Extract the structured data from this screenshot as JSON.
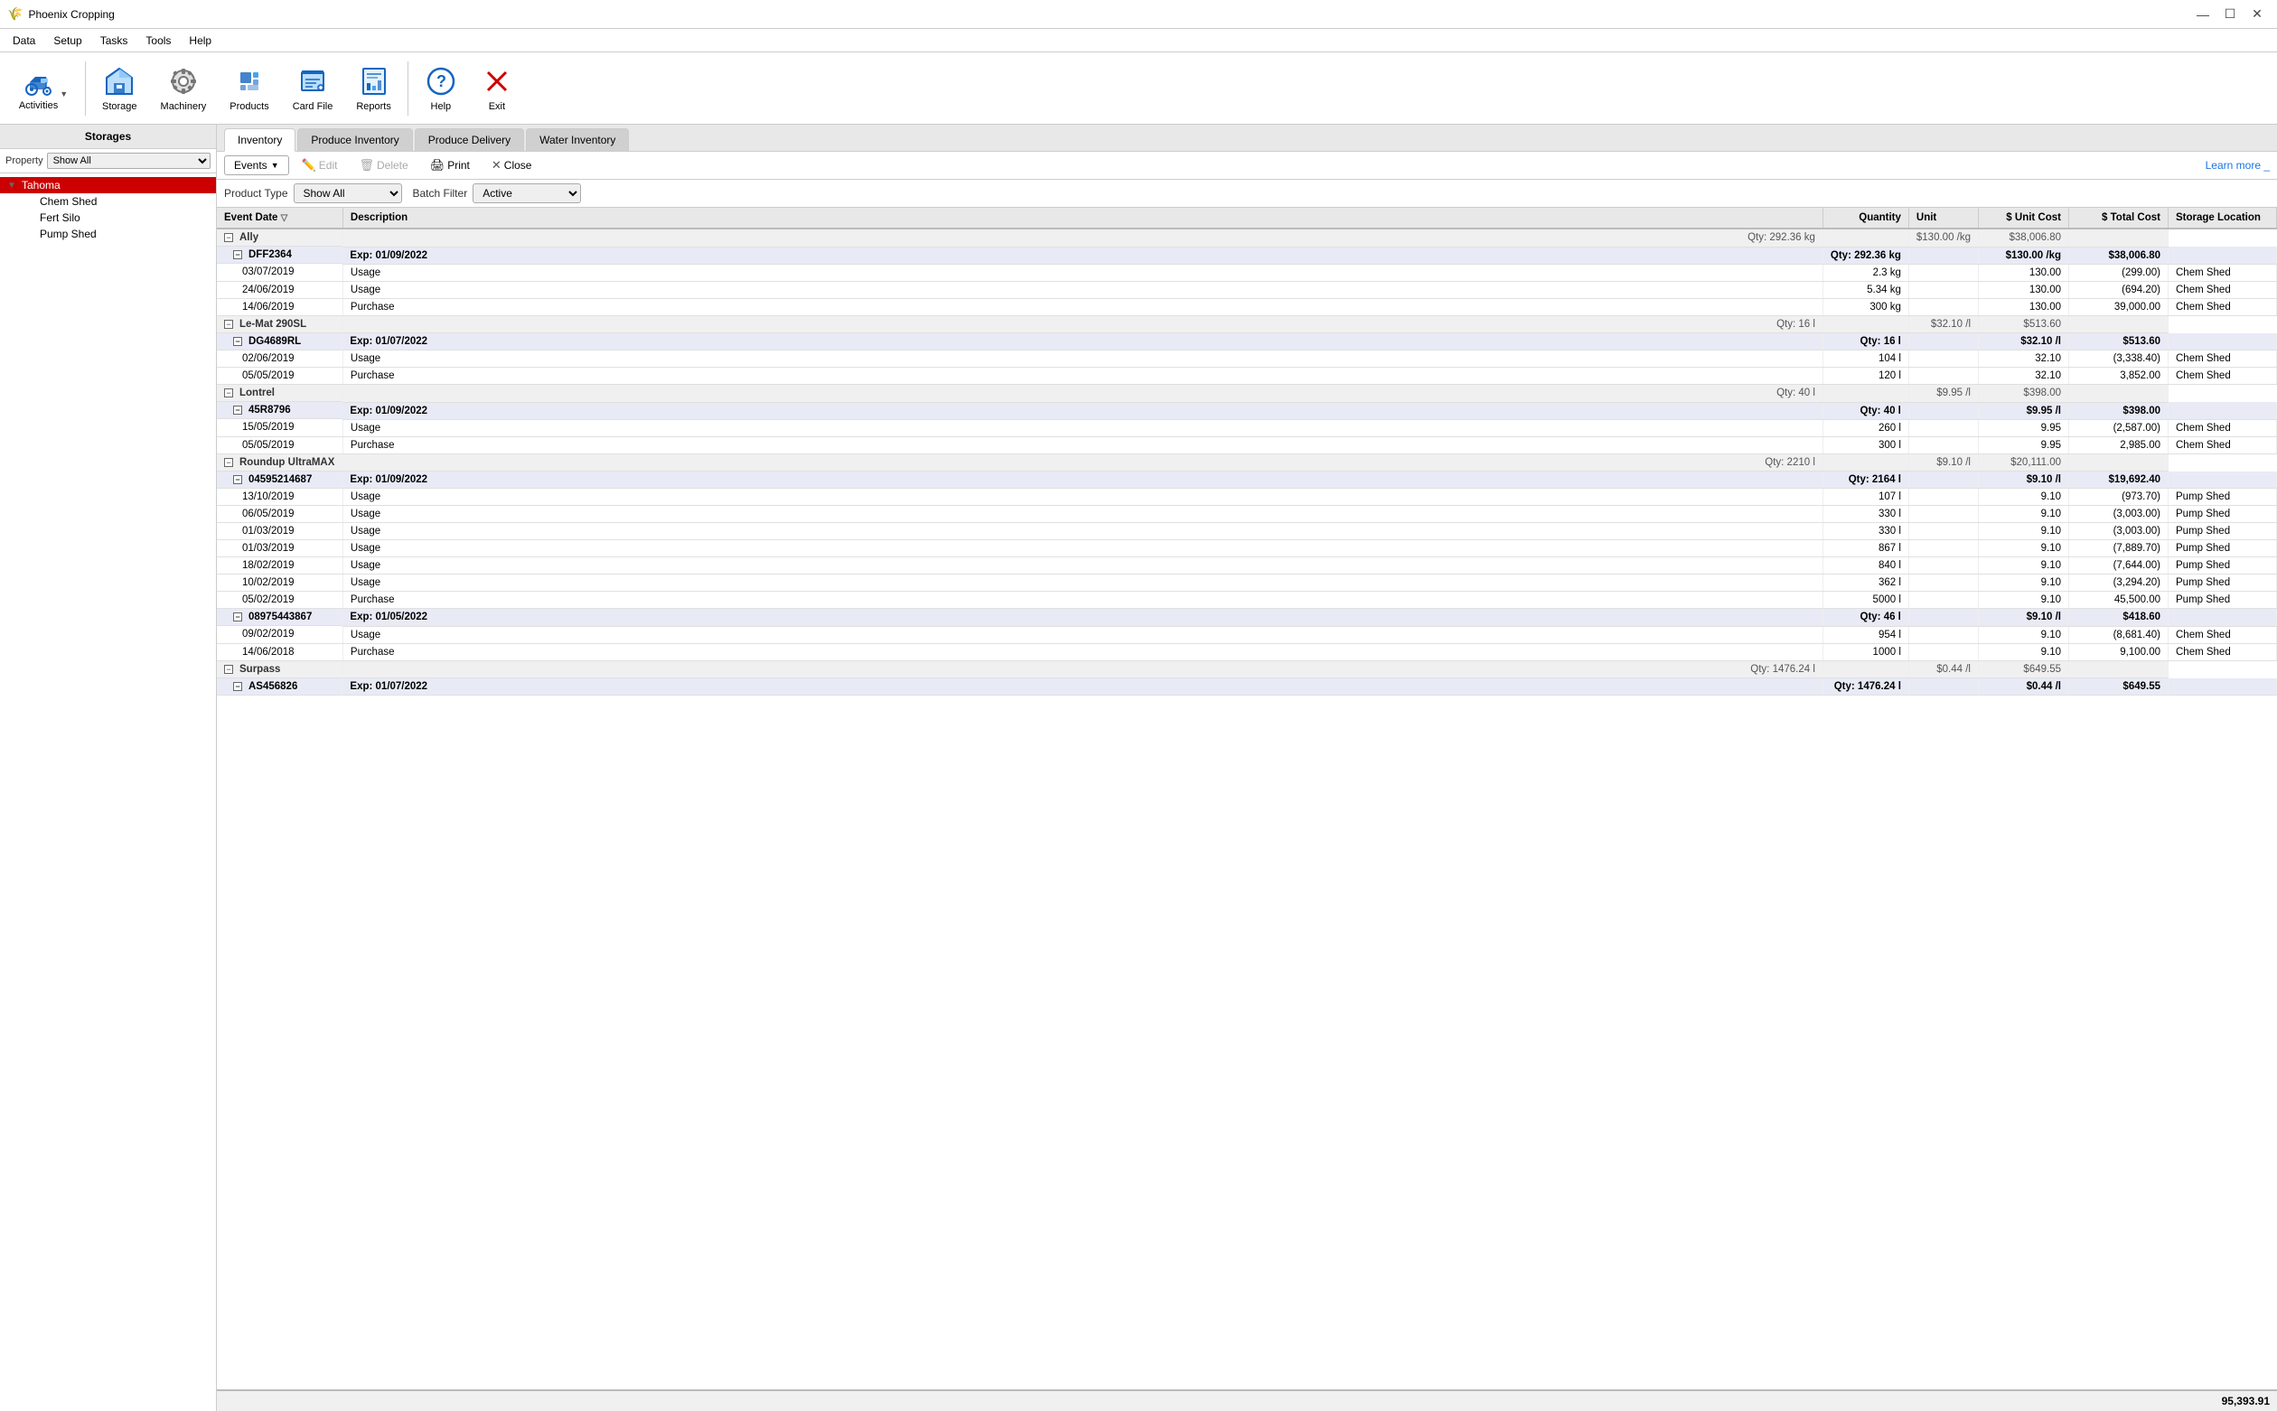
{
  "app": {
    "title": "Phoenix Cropping",
    "title_icon": "🌱"
  },
  "titlebar": {
    "minimize": "—",
    "maximize": "☐",
    "close": "✕"
  },
  "menu": {
    "items": [
      "Data",
      "Setup",
      "Tasks",
      "Tools",
      "Help"
    ]
  },
  "toolbar": {
    "buttons": [
      {
        "id": "activities",
        "label": "Activities",
        "icon": "🚜",
        "has_arrow": true
      },
      {
        "id": "storage",
        "label": "Storage",
        "icon": "🏚"
      },
      {
        "id": "machinery",
        "label": "Machinery",
        "icon": "⚙"
      },
      {
        "id": "products",
        "label": "Products",
        "icon": "📦"
      },
      {
        "id": "cardfile",
        "label": "Card File",
        "icon": "📋"
      },
      {
        "id": "reports",
        "label": "Reports",
        "icon": "📊"
      },
      {
        "id": "help",
        "label": "Help",
        "icon": "❓"
      },
      {
        "id": "exit",
        "label": "Exit",
        "icon": "✕"
      }
    ]
  },
  "sidebar": {
    "header": "Storages",
    "filter_label": "Property",
    "filter_value": "Show All",
    "filter_options": [
      "Show All"
    ],
    "tree": [
      {
        "id": "tahoma",
        "label": "Tahoma",
        "level": 0,
        "selected": true,
        "expanded": true
      },
      {
        "id": "chem-shed",
        "label": "Chem Shed",
        "level": 1
      },
      {
        "id": "fert-silo",
        "label": "Fert Silo",
        "level": 1
      },
      {
        "id": "pump-shed",
        "label": "Pump Shed",
        "level": 1
      }
    ]
  },
  "tabs": {
    "items": [
      {
        "id": "inventory",
        "label": "Inventory",
        "active": true
      },
      {
        "id": "produce-inventory",
        "label": "Produce Inventory",
        "active": false
      },
      {
        "id": "produce-delivery",
        "label": "Produce Delivery",
        "active": false
      },
      {
        "id": "water-inventory",
        "label": "Water Inventory",
        "active": false
      }
    ]
  },
  "action_bar": {
    "events_label": "Events",
    "edit_label": "Edit",
    "delete_label": "Delete",
    "print_label": "Print",
    "close_label": "Close",
    "learn_more": "Learn more _"
  },
  "filter_bar": {
    "product_type_label": "Product Type",
    "product_type_value": "Show All",
    "batch_filter_label": "Batch Filter",
    "batch_filter_value": "Active"
  },
  "table": {
    "columns": [
      {
        "id": "event-date",
        "label": "Event Date",
        "sortable": true
      },
      {
        "id": "description",
        "label": "Description"
      },
      {
        "id": "quantity",
        "label": "Quantity"
      },
      {
        "id": "unit",
        "label": "Unit"
      },
      {
        "id": "unit-cost",
        "label": "$ Unit Cost"
      },
      {
        "id": "total-cost",
        "label": "$ Total Cost"
      },
      {
        "id": "storage-location",
        "label": "Storage Location"
      }
    ],
    "rows": [
      {
        "type": "group-summary",
        "product": "Ally",
        "qty": "Qty: 292.36 kg",
        "unit_cost": "$130.00 /kg",
        "total_cost": "$38,006.80"
      },
      {
        "type": "batch",
        "batch": "DFF2364",
        "exp": "Exp: 01/09/2022",
        "qty": "Qty: 292.36 kg",
        "unit_cost": "$130.00 /kg",
        "total_cost": "$38,006.80"
      },
      {
        "type": "detail",
        "date": "03/07/2019",
        "desc": "Usage",
        "quantity": "2.3 kg",
        "unit_cost": "130.00",
        "total_cost": "(299.00)",
        "location": "Chem Shed"
      },
      {
        "type": "detail",
        "date": "24/06/2019",
        "desc": "Usage",
        "quantity": "5.34 kg",
        "unit_cost": "130.00",
        "total_cost": "(694.20)",
        "location": "Chem Shed"
      },
      {
        "type": "detail",
        "date": "14/06/2019",
        "desc": "Purchase",
        "quantity": "300 kg",
        "unit_cost": "130.00",
        "total_cost": "39,000.00",
        "location": "Chem Shed"
      },
      {
        "type": "group-summary",
        "product": "Le-Mat 290SL",
        "qty": "Qty: 16 l",
        "unit_cost": "$32.10 /l",
        "total_cost": "$513.60"
      },
      {
        "type": "batch",
        "batch": "DG4689RL",
        "exp": "Exp: 01/07/2022",
        "qty": "Qty: 16 l",
        "unit_cost": "$32.10 /l",
        "total_cost": "$513.60"
      },
      {
        "type": "detail",
        "date": "02/06/2019",
        "desc": "Usage",
        "quantity": "104 l",
        "unit_cost": "32.10",
        "total_cost": "(3,338.40)",
        "location": "Chem Shed"
      },
      {
        "type": "detail",
        "date": "05/05/2019",
        "desc": "Purchase",
        "quantity": "120 l",
        "unit_cost": "32.10",
        "total_cost": "3,852.00",
        "location": "Chem Shed"
      },
      {
        "type": "group-summary",
        "product": "Lontrel",
        "qty": "Qty: 40 l",
        "unit_cost": "$9.95 /l",
        "total_cost": "$398.00"
      },
      {
        "type": "batch",
        "batch": "45R8796",
        "exp": "Exp: 01/09/2022",
        "qty": "Qty: 40 l",
        "unit_cost": "$9.95 /l",
        "total_cost": "$398.00"
      },
      {
        "type": "detail",
        "date": "15/05/2019",
        "desc": "Usage",
        "quantity": "260 l",
        "unit_cost": "9.95",
        "total_cost": "(2,587.00)",
        "location": "Chem Shed"
      },
      {
        "type": "detail",
        "date": "05/05/2019",
        "desc": "Purchase",
        "quantity": "300 l",
        "unit_cost": "9.95",
        "total_cost": "2,985.00",
        "location": "Chem Shed"
      },
      {
        "type": "group-summary",
        "product": "Roundup UltraMAX",
        "qty": "Qty: 2210 l",
        "unit_cost": "$9.10 /l",
        "total_cost": "$20,111.00"
      },
      {
        "type": "batch",
        "batch": "04595214687",
        "exp": "Exp: 01/09/2022",
        "qty": "Qty: 2164 l",
        "unit_cost": "$9.10 /l",
        "total_cost": "$19,692.40"
      },
      {
        "type": "detail",
        "date": "13/10/2019",
        "desc": "Usage",
        "quantity": "107 l",
        "unit_cost": "9.10",
        "total_cost": "(973.70)",
        "location": "Pump Shed"
      },
      {
        "type": "detail",
        "date": "06/05/2019",
        "desc": "Usage",
        "quantity": "330 l",
        "unit_cost": "9.10",
        "total_cost": "(3,003.00)",
        "location": "Pump Shed"
      },
      {
        "type": "detail",
        "date": "01/03/2019",
        "desc": "Usage",
        "quantity": "330 l",
        "unit_cost": "9.10",
        "total_cost": "(3,003.00)",
        "location": "Pump Shed"
      },
      {
        "type": "detail",
        "date": "01/03/2019",
        "desc": "Usage",
        "quantity": "867 l",
        "unit_cost": "9.10",
        "total_cost": "(7,889.70)",
        "location": "Pump Shed"
      },
      {
        "type": "detail",
        "date": "18/02/2019",
        "desc": "Usage",
        "quantity": "840 l",
        "unit_cost": "9.10",
        "total_cost": "(7,644.00)",
        "location": "Pump Shed"
      },
      {
        "type": "detail",
        "date": "10/02/2019",
        "desc": "Usage",
        "quantity": "362 l",
        "unit_cost": "9.10",
        "total_cost": "(3,294.20)",
        "location": "Pump Shed"
      },
      {
        "type": "detail",
        "date": "05/02/2019",
        "desc": "Purchase",
        "quantity": "5000 l",
        "unit_cost": "9.10",
        "total_cost": "45,500.00",
        "location": "Pump Shed"
      },
      {
        "type": "batch",
        "batch": "08975443867",
        "exp": "Exp: 01/05/2022",
        "qty": "Qty: 46 l",
        "unit_cost": "$9.10 /l",
        "total_cost": "$418.60"
      },
      {
        "type": "detail",
        "date": "09/02/2019",
        "desc": "Usage",
        "quantity": "954 l",
        "unit_cost": "9.10",
        "total_cost": "(8,681.40)",
        "location": "Chem Shed"
      },
      {
        "type": "detail",
        "date": "14/06/2018",
        "desc": "Purchase",
        "quantity": "1000 l",
        "unit_cost": "9.10",
        "total_cost": "9,100.00",
        "location": "Chem Shed"
      },
      {
        "type": "group-summary",
        "product": "Surpass",
        "qty": "Qty: 1476.24 l",
        "unit_cost": "$0.44 /l",
        "total_cost": "$649.55"
      },
      {
        "type": "batch",
        "batch": "AS456826",
        "exp": "Exp: 01/07/2022",
        "qty": "Qty: 1476.24 l",
        "unit_cost": "$0.44 /l",
        "total_cost": "$649.55"
      }
    ],
    "footer_total": "95,393.91"
  }
}
